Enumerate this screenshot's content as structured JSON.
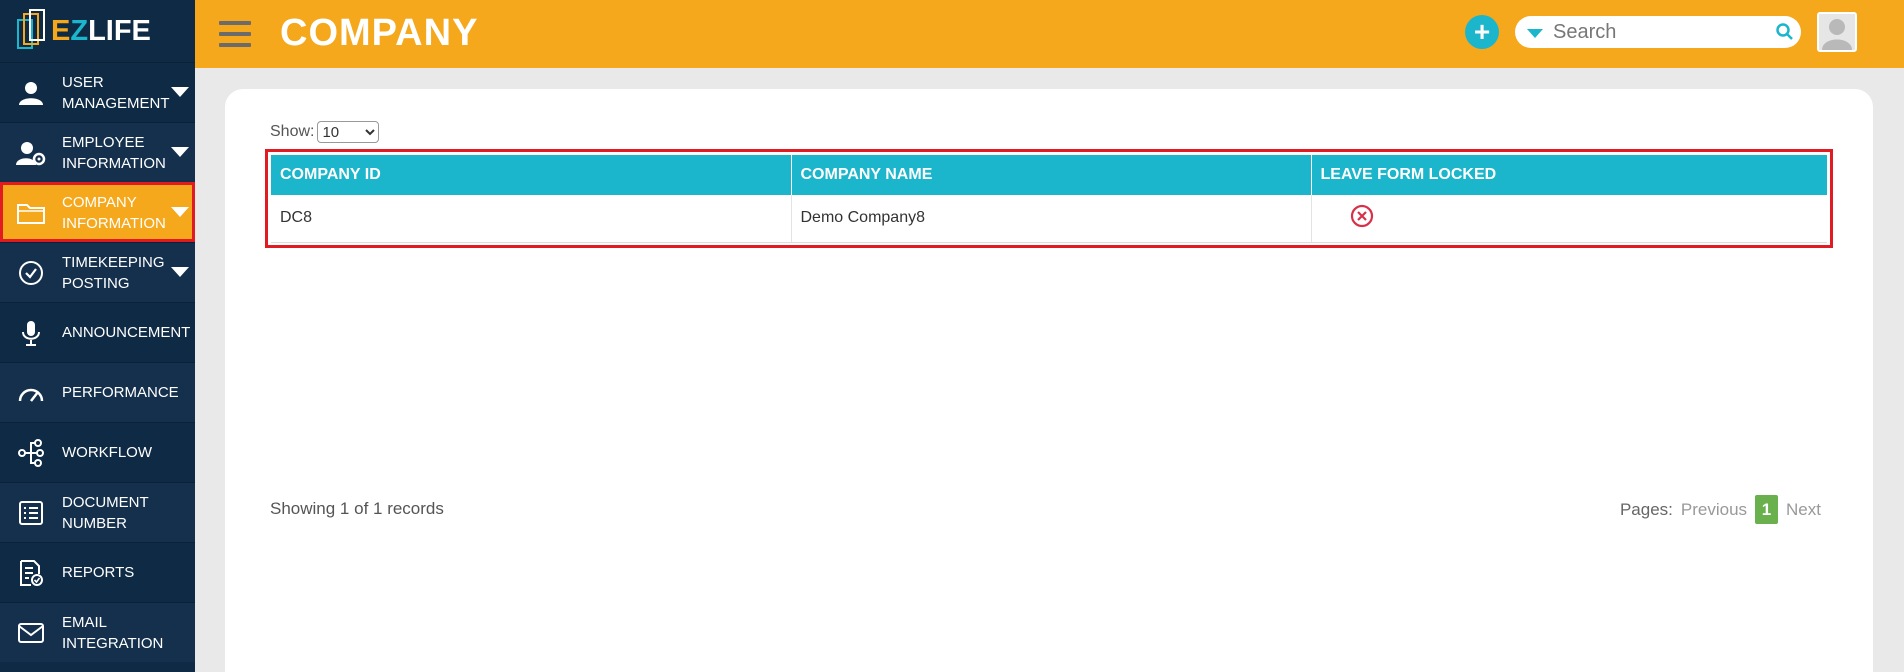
{
  "brand": {
    "e": "E",
    "z": "Z",
    "rest": "LIFE"
  },
  "header": {
    "title": "COMPANY",
    "search_placeholder": "Search",
    "add_label": "+"
  },
  "sidebar": {
    "items": [
      {
        "label": "USER MANAGEMENT",
        "icon": "user-icon",
        "has_caret": true
      },
      {
        "label": "EMPLOYEE INFORMATION",
        "icon": "user-gear-icon",
        "has_caret": true
      },
      {
        "label": "COMPANY INFORMATION",
        "icon": "folder-icon",
        "has_caret": true,
        "active": true
      },
      {
        "label": "TIMEKEEPING POSTING",
        "icon": "check-circle-icon",
        "has_caret": true
      },
      {
        "label": "ANNOUNCEMENT",
        "icon": "microphone-icon",
        "has_caret": false
      },
      {
        "label": "PERFORMANCE",
        "icon": "gauge-icon",
        "has_caret": false
      },
      {
        "label": "WORKFLOW",
        "icon": "workflow-icon",
        "has_caret": false
      },
      {
        "label": "DOCUMENT NUMBER",
        "icon": "document-list-icon",
        "has_caret": false
      },
      {
        "label": "REPORTS",
        "icon": "report-icon",
        "has_caret": false
      },
      {
        "label": "EMAIL INTEGRATION",
        "icon": "envelope-icon",
        "has_caret": false
      }
    ]
  },
  "table": {
    "show_label": "Show:",
    "page_size": "10",
    "columns": [
      "COMPANY ID",
      "COMPANY NAME",
      "LEAVE FORM LOCKED"
    ],
    "rows": [
      {
        "company_id": "DC8",
        "company_name": "Demo Company8",
        "leave_form_locked": "no-icon"
      }
    ]
  },
  "footer": {
    "records": "Showing 1 of 1 records",
    "pages_label": "Pages:",
    "previous": "Previous",
    "current_page": "1",
    "next": "Next"
  },
  "colors": {
    "header": "#f5a81c",
    "sidebar": "#0f2a44",
    "table_header": "#1bb6cc",
    "highlight": "#e01b22",
    "pager_active": "#6ab04c"
  }
}
